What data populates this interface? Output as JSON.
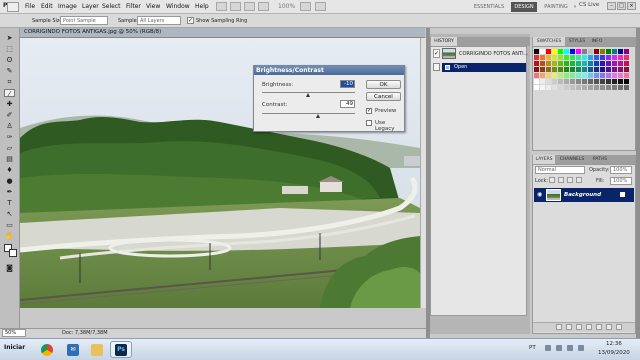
{
  "menubar": {
    "app_logo": "Ps",
    "items": [
      "File",
      "Edit",
      "Image",
      "Layer",
      "Select",
      "Filter",
      "View",
      "Window",
      "Help"
    ],
    "zoom": "100%",
    "workspaces": [
      "ESSENTIALS",
      "DESIGN",
      "PAINTING"
    ],
    "active_workspace": "DESIGN",
    "overflow": "»",
    "cs_live": "CS Live"
  },
  "options": {
    "sample_size_label": "Sample Size:",
    "sample_size_value": "Point Sample",
    "sample_label": "Sample:",
    "sample_value": "All Layers",
    "show_ring_label": "Show Sampling Ring",
    "show_ring_checked": "✓"
  },
  "document": {
    "tab_title": "CORRIGINDO FOTOS ANTIGAS.jpg @ 50% (RGB/8)",
    "zoom": "50%",
    "doc_info": "Doc: 7,38M/7,38M"
  },
  "dialog": {
    "title": "Brightness/Contrast",
    "brightness_label": "Brightness:",
    "brightness_value": "-10",
    "contrast_label": "Contrast:",
    "contrast_value": "49",
    "ok_label": "OK",
    "cancel_label": "Cancel",
    "preview_label": "Preview",
    "preview_checked": "✓",
    "legacy_label": "Use Legacy",
    "brightness_slider_fraction": 0.49,
    "contrast_slider_fraction": 0.6
  },
  "history": {
    "tab_label": "HISTORY",
    "snapshot_name": "CORRIGINDO FOTOS ANTI...",
    "steps": [
      "Open"
    ]
  },
  "swatches": {
    "tabs": [
      "SWATCHES",
      "STYLES",
      "INFO"
    ],
    "active_tab": "SWATCHES"
  },
  "layers": {
    "tabs": [
      "LAYERS",
      "CHANNELS",
      "PATHS"
    ],
    "active_tab": "LAYERS",
    "blend_mode": "Normal",
    "opacity_label": "Opacity:",
    "opacity_value": "100%",
    "lock_label": "Lock:",
    "fill_label": "Fill:",
    "fill_value": "100%",
    "layer_name": "Background"
  },
  "taskbar": {
    "start_label": "Iniciar",
    "apps": [
      "chrome",
      "mail",
      "explorer",
      "photoshop"
    ],
    "lang": "PT",
    "time": "12:36",
    "date": "13/09/2020"
  },
  "colors": {
    "selection_blue": "#0a246a",
    "dialog_title": "#4b6a96",
    "panel_bg": "#d8d8d8"
  }
}
